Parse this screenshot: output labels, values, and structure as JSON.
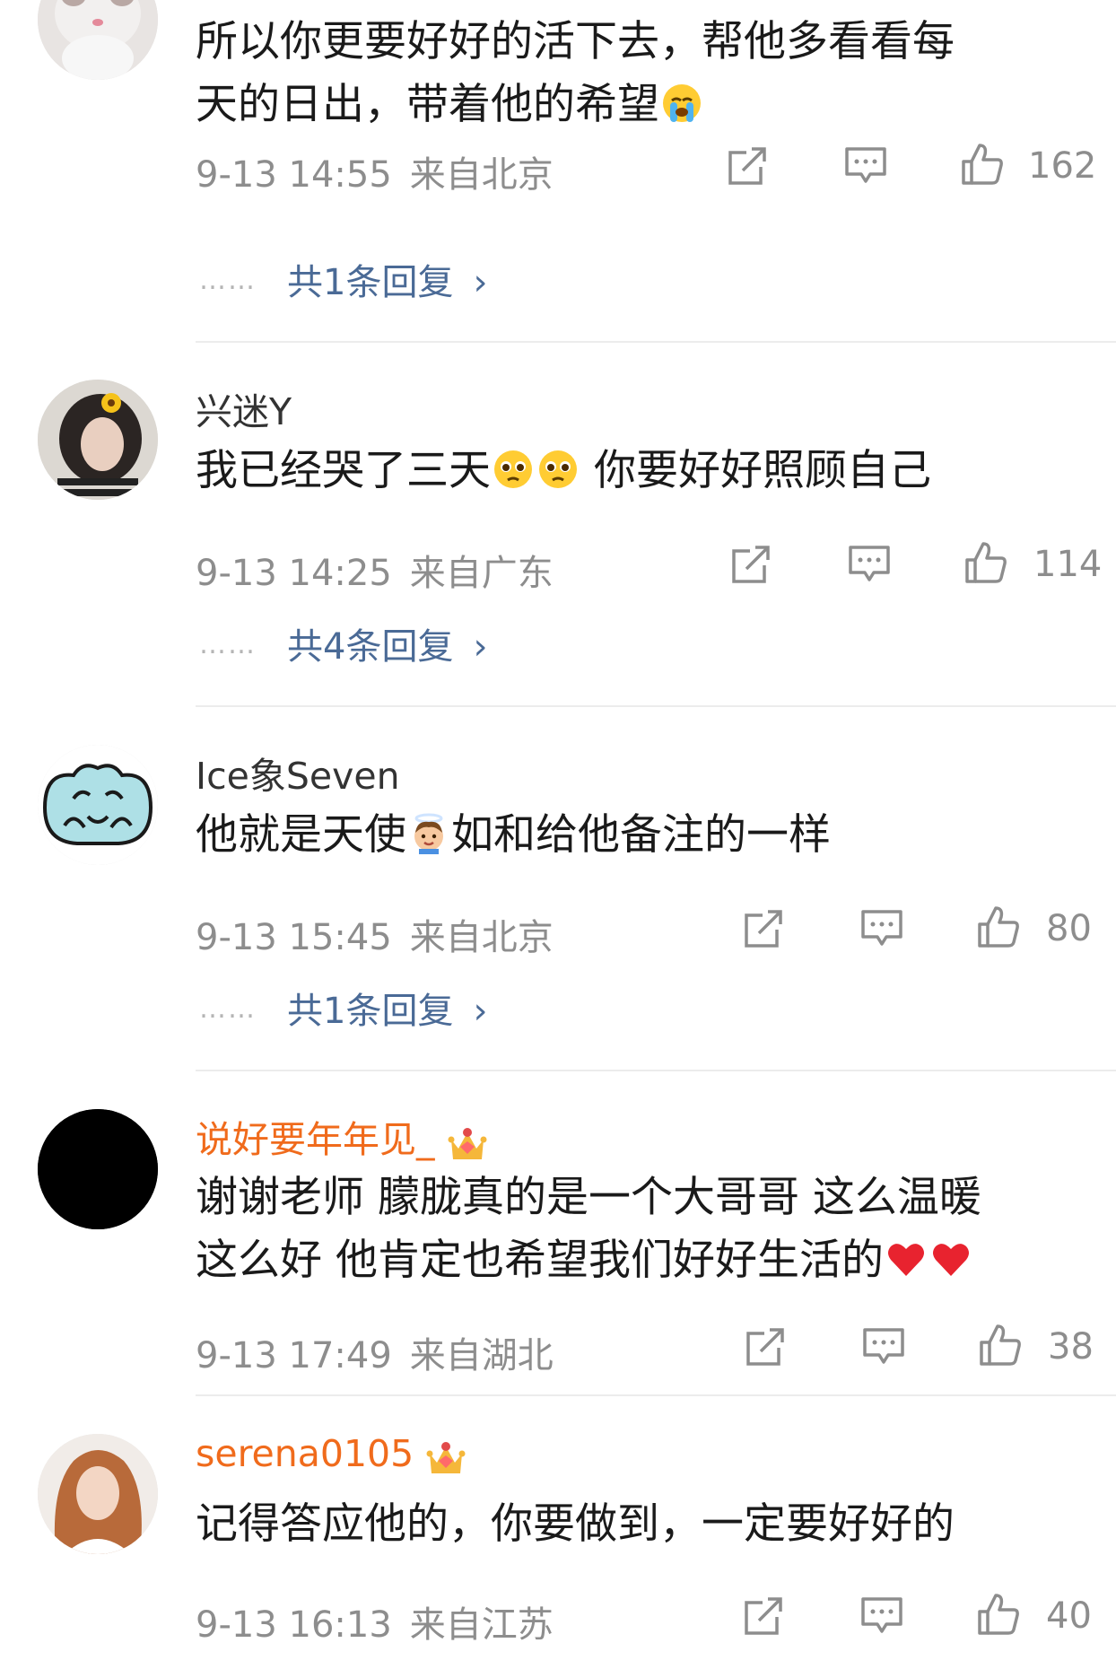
{
  "comments": [
    {
      "username": "",
      "text_line1": "所以你更要好好的活下去，帮他多看看每",
      "text_line2": "天的日出，带着他的希望",
      "text_emoji": "crying-face-emoji",
      "time": "9-13 14:55",
      "location": "来自北京",
      "likes": "162",
      "replies": "共1条回复"
    },
    {
      "username": "兴迷Y",
      "text_part1": "我已经哭了三天",
      "text_emoji": "pleading-face-emoji",
      "text_part2": " 你要好好照顾自己",
      "time": "9-13 14:25",
      "location": "来自广东",
      "likes": "114",
      "replies": "共4条回复"
    },
    {
      "username": "Ice象Seven",
      "text_part1": "他就是天使",
      "text_emoji": "angel-emoji",
      "text_part2": "如和给他备注的一样",
      "time": "9-13 15:45",
      "location": "来自北京",
      "likes": "80",
      "replies": "共1条回复"
    },
    {
      "username": "说好要年年见_",
      "text_line1": "谢谢老师 朦胧真的是一个大哥哥 这么温暖",
      "text_line2": "这么好 他肯定也希望我们好好生活的",
      "text_emoji": "red-heart-emoji",
      "time": "9-13 17:49",
      "location": "来自湖北",
      "likes": "38"
    },
    {
      "username": "serena0105",
      "text_line1": "记得答应他的，你要做到，一定要好好的",
      "time": "9-13 16:13",
      "location": "来自江苏",
      "likes": "40"
    }
  ],
  "icons": {
    "share": "share-icon",
    "comment": "comment-icon",
    "like": "thumbs-up-icon",
    "chevron": "chevron-right-icon",
    "vip": "crown-badge-icon"
  },
  "colors": {
    "vip_name": "#f06b1c",
    "reply_link": "#4a6a96",
    "meta": "#8d8d8d"
  }
}
